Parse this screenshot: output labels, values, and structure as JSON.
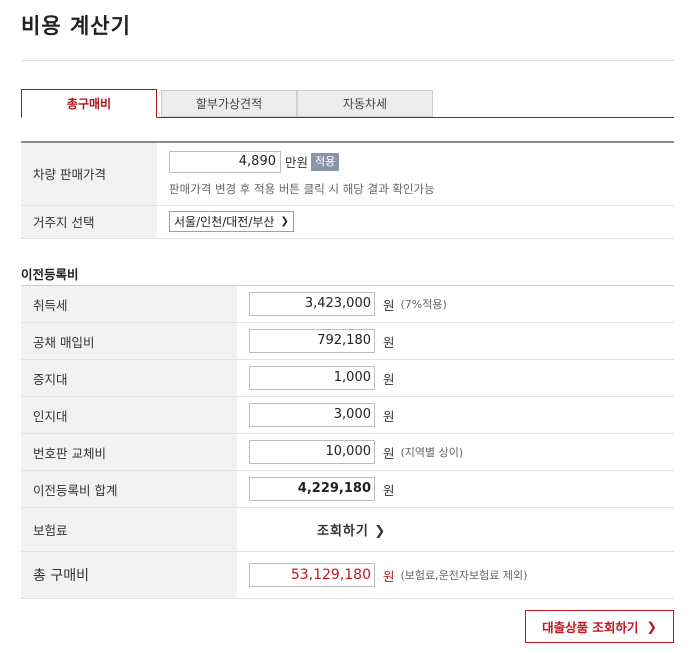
{
  "page": {
    "title": "비용 계산기"
  },
  "tabs": [
    {
      "label": "총구매비",
      "active": true
    },
    {
      "label": "할부가상견적",
      "active": false
    },
    {
      "label": "자동차세",
      "active": false
    }
  ],
  "vehicle_price": {
    "label": "차량 판매가격",
    "value": "4,890",
    "unit": "만원",
    "apply_label": "적용",
    "hint": "판매가격 변경 후 적용 버튼 클릭 시 해당 결과 확인가능"
  },
  "residence": {
    "label": "거주지 선택",
    "selected": "서울/인천/대전/부산"
  },
  "transfer_fees": {
    "section_title": "이전등록비",
    "currency": "원",
    "rows": [
      {
        "label": "취득세",
        "value": "3,423,000",
        "note": "(7%적용)"
      },
      {
        "label": "공채 매입비",
        "value": "792,180",
        "note": ""
      },
      {
        "label": "증지대",
        "value": "1,000",
        "note": ""
      },
      {
        "label": "인지대",
        "value": "3,000",
        "note": ""
      },
      {
        "label": "번호판 교체비",
        "value": "10,000",
        "note": "(지역별 상이)"
      },
      {
        "label": "이전등록비 합계",
        "value": "4,229,180",
        "note": ""
      }
    ]
  },
  "insurance": {
    "label": "보험료",
    "link_label": "조회하기"
  },
  "total": {
    "label": "총 구매비",
    "value": "53,129,180",
    "currency": "원",
    "note": "(보험료,운전자보험료 제외)"
  },
  "loan_button": {
    "label": "대출상품 조회하기"
  },
  "colors": {
    "accent": "#c0161e",
    "apply_button": "#8a95a8"
  }
}
